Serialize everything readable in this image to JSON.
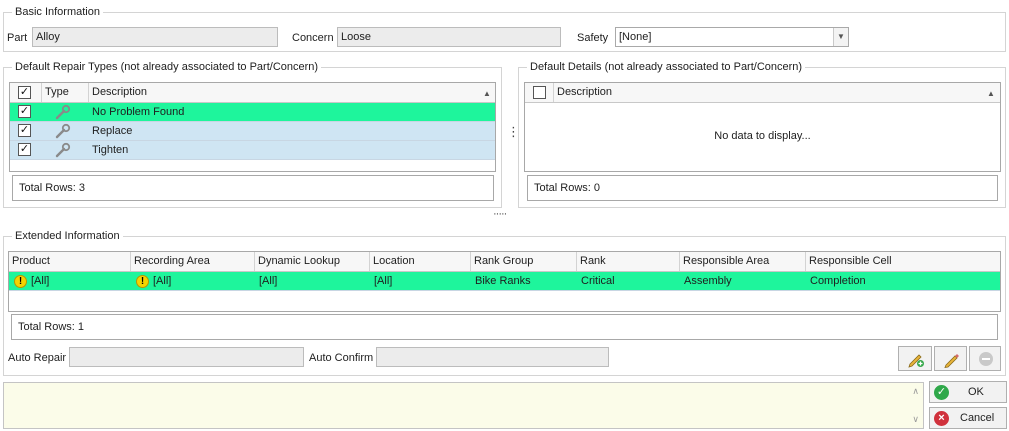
{
  "basic": {
    "title": "Basic Information",
    "part_label": "Part",
    "part_value": "Alloy",
    "concern_label": "Concern",
    "concern_value": "Loose",
    "safety_label": "Safety",
    "safety_value": "[None]"
  },
  "repair_types": {
    "title": "Default Repair Types (not already associated to Part/Concern)",
    "columns": [
      "Type",
      "Description"
    ],
    "rows": [
      {
        "description": "No Problem Found",
        "checked": true
      },
      {
        "description": "Replace",
        "checked": true
      },
      {
        "description": "Tighten",
        "checked": true
      }
    ],
    "total": "Total Rows: 3"
  },
  "details": {
    "title": "Default Details (not already associated to Part/Concern)",
    "columns": [
      "Description"
    ],
    "empty_text": "No data to display...",
    "total": "Total Rows: 0"
  },
  "extended": {
    "title": "Extended Information",
    "columns": [
      "Product",
      "Recording Area",
      "Dynamic Lookup",
      "Location",
      "Rank Group",
      "Rank",
      "Responsible Area",
      "Responsible Cell"
    ],
    "rows": [
      {
        "product": "[All]",
        "recording_area": "[All]",
        "dynamic_lookup": "[All]",
        "location": "[All]",
        "rank_group": "Bike Ranks",
        "rank": "Critical",
        "responsible_area": "Assembly",
        "responsible_cell": "Completion"
      }
    ],
    "total": "Total Rows: 1",
    "auto_repair_label": "Auto Repair",
    "auto_repair_value": "",
    "auto_confirm_label": "Auto Confirm",
    "auto_confirm_value": ""
  },
  "actions": {
    "ok_label": "OK",
    "cancel_label": "Cancel"
  },
  "icons": {
    "sort_up": "▲",
    "check": "✓",
    "warning": "!",
    "splitter_v": "⋮",
    "splitter_h": "·····"
  },
  "colors": {
    "selected_row": "#1ef59c",
    "alt_row": "#cfe5f3",
    "notes_bg": "#fbfce9",
    "ok_green": "#2fa84a",
    "cancel_red": "#d0313c"
  }
}
